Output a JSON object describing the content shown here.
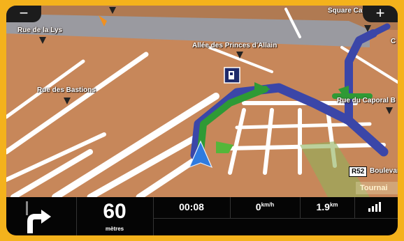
{
  "streets": {
    "rue_de_la_lys": "Rue de la Lys",
    "square": "Square Ca",
    "allee": "Allée des Princes d'Allain",
    "rue_des_bastions": "Rue des Bastions",
    "rue_du_caporal": "Rue du Caporal B",
    "boulevard": "Boulevar",
    "right_cut": "C"
  },
  "road_shield": "R52",
  "city": "Tournai",
  "zoom": {
    "out_label": "−",
    "in_label": "+"
  },
  "instruction": {
    "distance": "60",
    "distance_unit": "mètres",
    "turn_icon": "turn-right-icon"
  },
  "status": {
    "time": "00:08",
    "speed_value": "0",
    "speed_unit": "km/h",
    "remaining_value": "1.9",
    "remaining_unit": "km"
  },
  "colors": {
    "route": "#3b46a8",
    "next_turn": "#2e9a35",
    "ground": "#c7875a",
    "device": "#f4b21c"
  }
}
